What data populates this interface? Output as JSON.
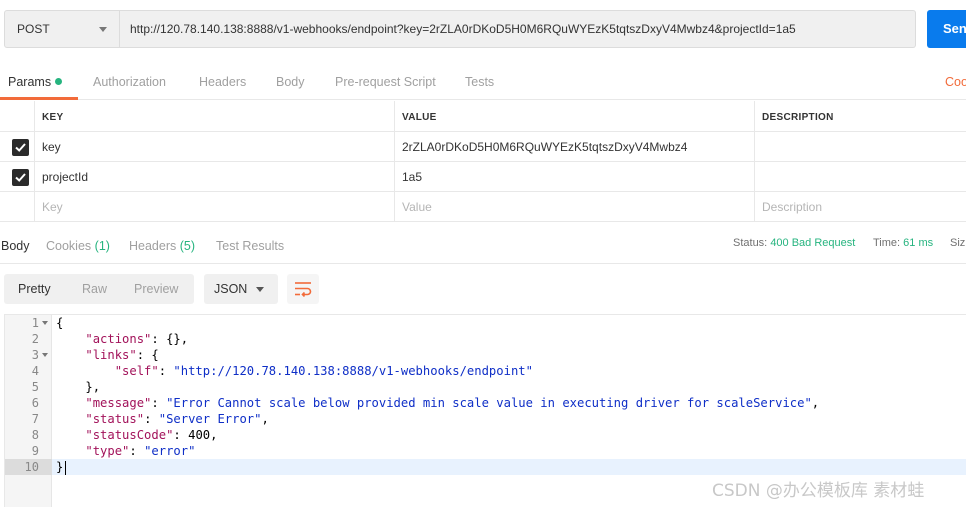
{
  "request": {
    "method": "POST",
    "url": "http://120.78.140.138:8888/v1-webhooks/endpoint?key=2rZLA0rDKoD5H0M6RQuWYEzK5tqtszDxyV4Mwbz4&projectId=1a5",
    "send_label": "Sen"
  },
  "request_tabs": {
    "params": "Params",
    "authorization": "Authorization",
    "headers": "Headers",
    "body": "Body",
    "prerequest": "Pre-request Script",
    "tests": "Tests",
    "cookies": "Coo"
  },
  "params_table": {
    "headers": {
      "key": "KEY",
      "value": "VALUE",
      "description": "DESCRIPTION"
    },
    "rows": [
      {
        "key": "key",
        "value": "2rZLA0rDKoD5H0M6RQuWYEzK5tqtszDxyV4Mwbz4",
        "checked": true
      },
      {
        "key": "projectId",
        "value": "1a5",
        "checked": true
      }
    ],
    "placeholders": {
      "key": "Key",
      "value": "Value",
      "description": "Description"
    }
  },
  "response_tabs": {
    "body": "Body",
    "cookies": "Cookies",
    "cookies_count": "(1)",
    "headers": "Headers",
    "headers_count": "(5)",
    "test_results": "Test Results"
  },
  "response_meta": {
    "status_label": "Status:",
    "status_value": "400 Bad Request",
    "time_label": "Time:",
    "time_value": "61 ms",
    "size_label": "Siz"
  },
  "response_toolbar": {
    "pretty": "Pretty",
    "raw": "Raw",
    "preview": "Preview",
    "format": "JSON"
  },
  "response_body": {
    "line_numbers": [
      "1",
      "2",
      "3",
      "4",
      "5",
      "6",
      "7",
      "8",
      "9",
      "10"
    ],
    "l1": "{",
    "l2_key": "\"actions\"",
    "l2_rest": ": {},",
    "l3_key": "\"links\"",
    "l3_rest": ": {",
    "l4_key": "\"self\"",
    "l4_sep": ": ",
    "l4_val": "\"http://120.78.140.138:8888/v1-webhooks/endpoint\"",
    "l5": "},",
    "l6_key": "\"message\"",
    "l6_sep": ": ",
    "l6_val": "\"Error Cannot scale below provided min scale value in executing driver for scaleService\"",
    "l6_end": ",",
    "l7_key": "\"status\"",
    "l7_sep": ": ",
    "l7_val": "\"Server Error\"",
    "l7_end": ",",
    "l8_key": "\"statusCode\"",
    "l8_sep": ": ",
    "l8_val": "400",
    "l8_end": ",",
    "l9_key": "\"type\"",
    "l9_sep": ": ",
    "l9_val": "\"error\"",
    "l10": "}"
  },
  "watermark": "CSDN @办公模板库 素材蛙"
}
